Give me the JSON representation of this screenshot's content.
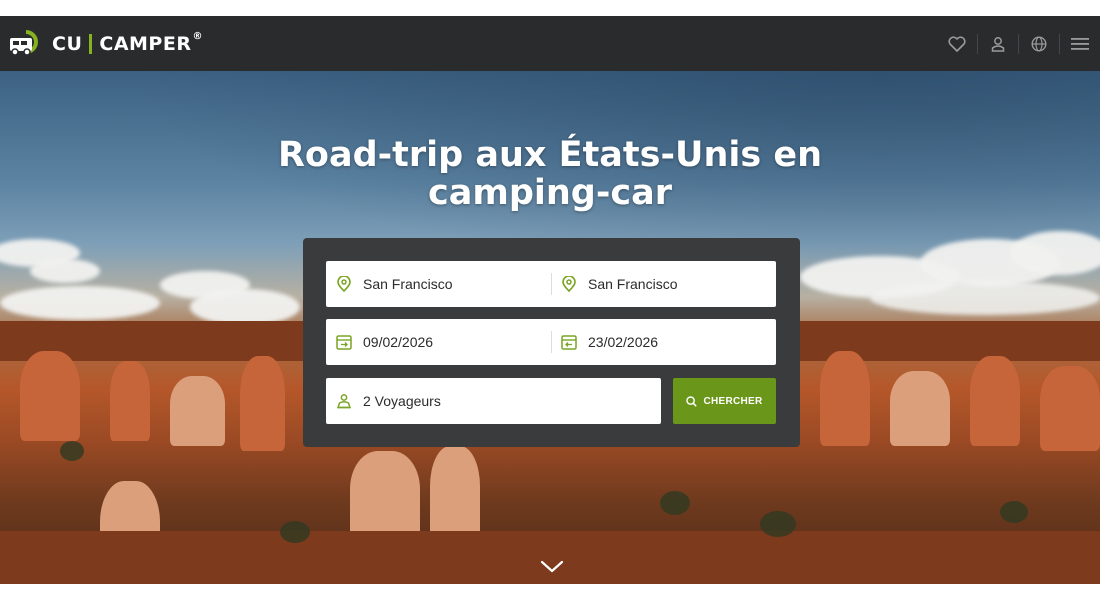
{
  "brand": {
    "name_left": "CU",
    "name_right": "CAMPER",
    "registered": "®",
    "icon": "camper-van-icon",
    "accent_color": "#86b221"
  },
  "nav": {
    "icons": [
      "heart-icon",
      "user-icon",
      "globe-icon",
      "menu-icon"
    ]
  },
  "hero": {
    "title": "Road-trip aux États-Unis en camping-car"
  },
  "search": {
    "pickup_location": "San Francisco",
    "dropoff_location": "San Francisco",
    "start_date": "09/02/2026",
    "end_date": "23/02/2026",
    "travelers": "2 Voyageurs",
    "button_label": "CHERCHER",
    "button_color": "#6a961a"
  }
}
